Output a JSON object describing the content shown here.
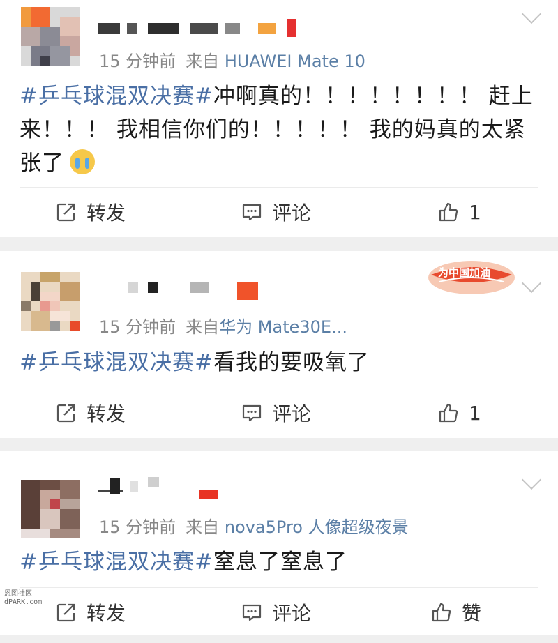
{
  "posts": [
    {
      "time": "15 分钟前",
      "from_prefix": "来自",
      "source": "HUAWEI Mate 10",
      "topic": "#乒乓球混双决赛#",
      "body_lines": [
        "冲啊真的！！！！！！！！ 赶上",
        "来！！！ 我相信你们的！！！！！ 我的妈真的太紧",
        "张了"
      ],
      "emoji_icon": "crying-face-icon",
      "actions": {
        "repost": "转发",
        "comment": "评论",
        "like": "1"
      }
    },
    {
      "time": "15 分钟前",
      "from_prefix": "来自",
      "source": "华为 Mate30E...",
      "badge": "为中国加油",
      "topic": "#乒乓球混双决赛#",
      "body": "看我的要吸氧了",
      "actions": {
        "repost": "转发",
        "comment": "评论",
        "like": "1"
      }
    },
    {
      "time": "15 分钟前",
      "from_prefix": "来自",
      "source": "nova5Pro 人像超级夜景",
      "topic": "#乒乓球混双决赛#",
      "body": "窒息了窒息了",
      "actions": {
        "repost": "转发",
        "comment": "评论",
        "like": "赞"
      }
    }
  ],
  "watermark": {
    "line1": "恩图社区",
    "line2": "dPARK.com"
  },
  "colors": {
    "link": "#5b7fa6",
    "topic": "#4a6fa5",
    "meta": "#888888",
    "text": "#1a1a1a",
    "separator": "#efefef"
  },
  "icons": [
    "repost-icon",
    "comment-icon",
    "like-icon",
    "chevron-down-icon",
    "crying-face-icon"
  ]
}
